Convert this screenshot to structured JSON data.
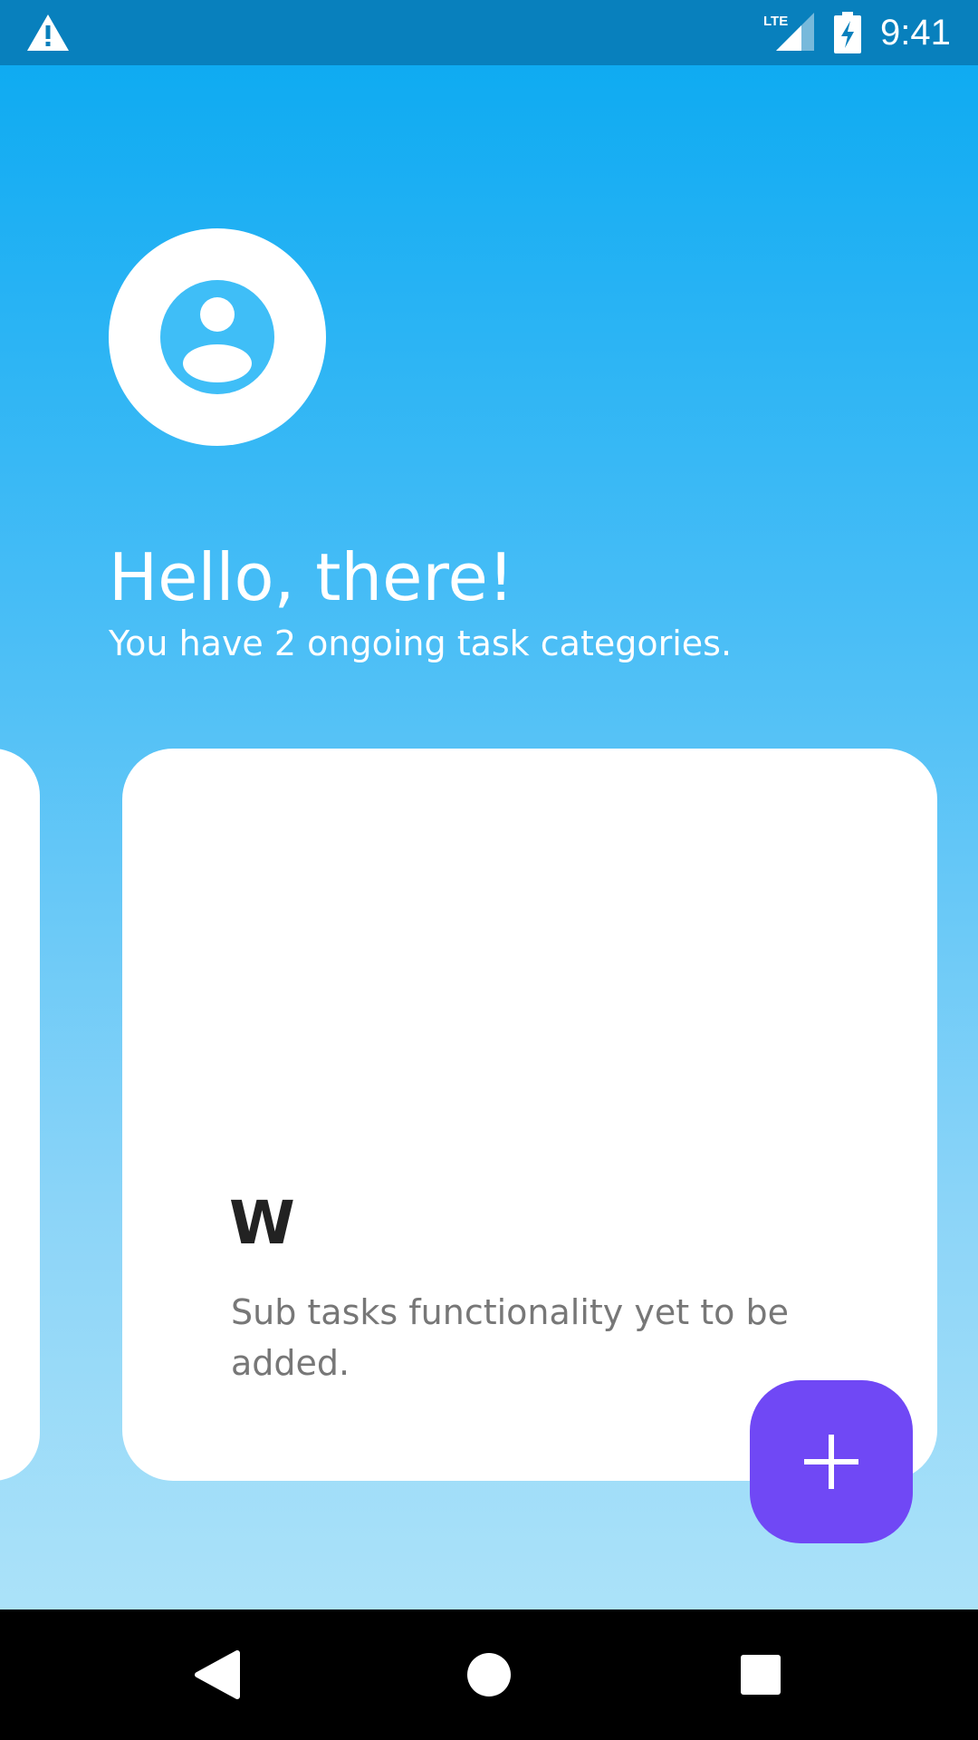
{
  "status_bar": {
    "network": "LTE",
    "time": "9:41",
    "icons": [
      "warning-icon",
      "lte-signal-icon",
      "battery-charging-icon"
    ]
  },
  "home": {
    "greeting": "Hello, there!",
    "subtitle": "You have 2 ongoing task categories.",
    "avatar_icon": "account-circle-icon"
  },
  "categories": [
    {
      "title": "W",
      "description": "Sub tasks functionality yet to be added."
    }
  ],
  "fab": {
    "icon": "plus-icon",
    "color": "#7048f5"
  },
  "colors": {
    "gradient_top": "#0fabf2",
    "gradient_bottom": "#abe2f9",
    "status_bar": "#0880bd"
  },
  "nav_bar": {
    "icons": [
      "back-icon",
      "home-icon",
      "recents-icon"
    ]
  }
}
